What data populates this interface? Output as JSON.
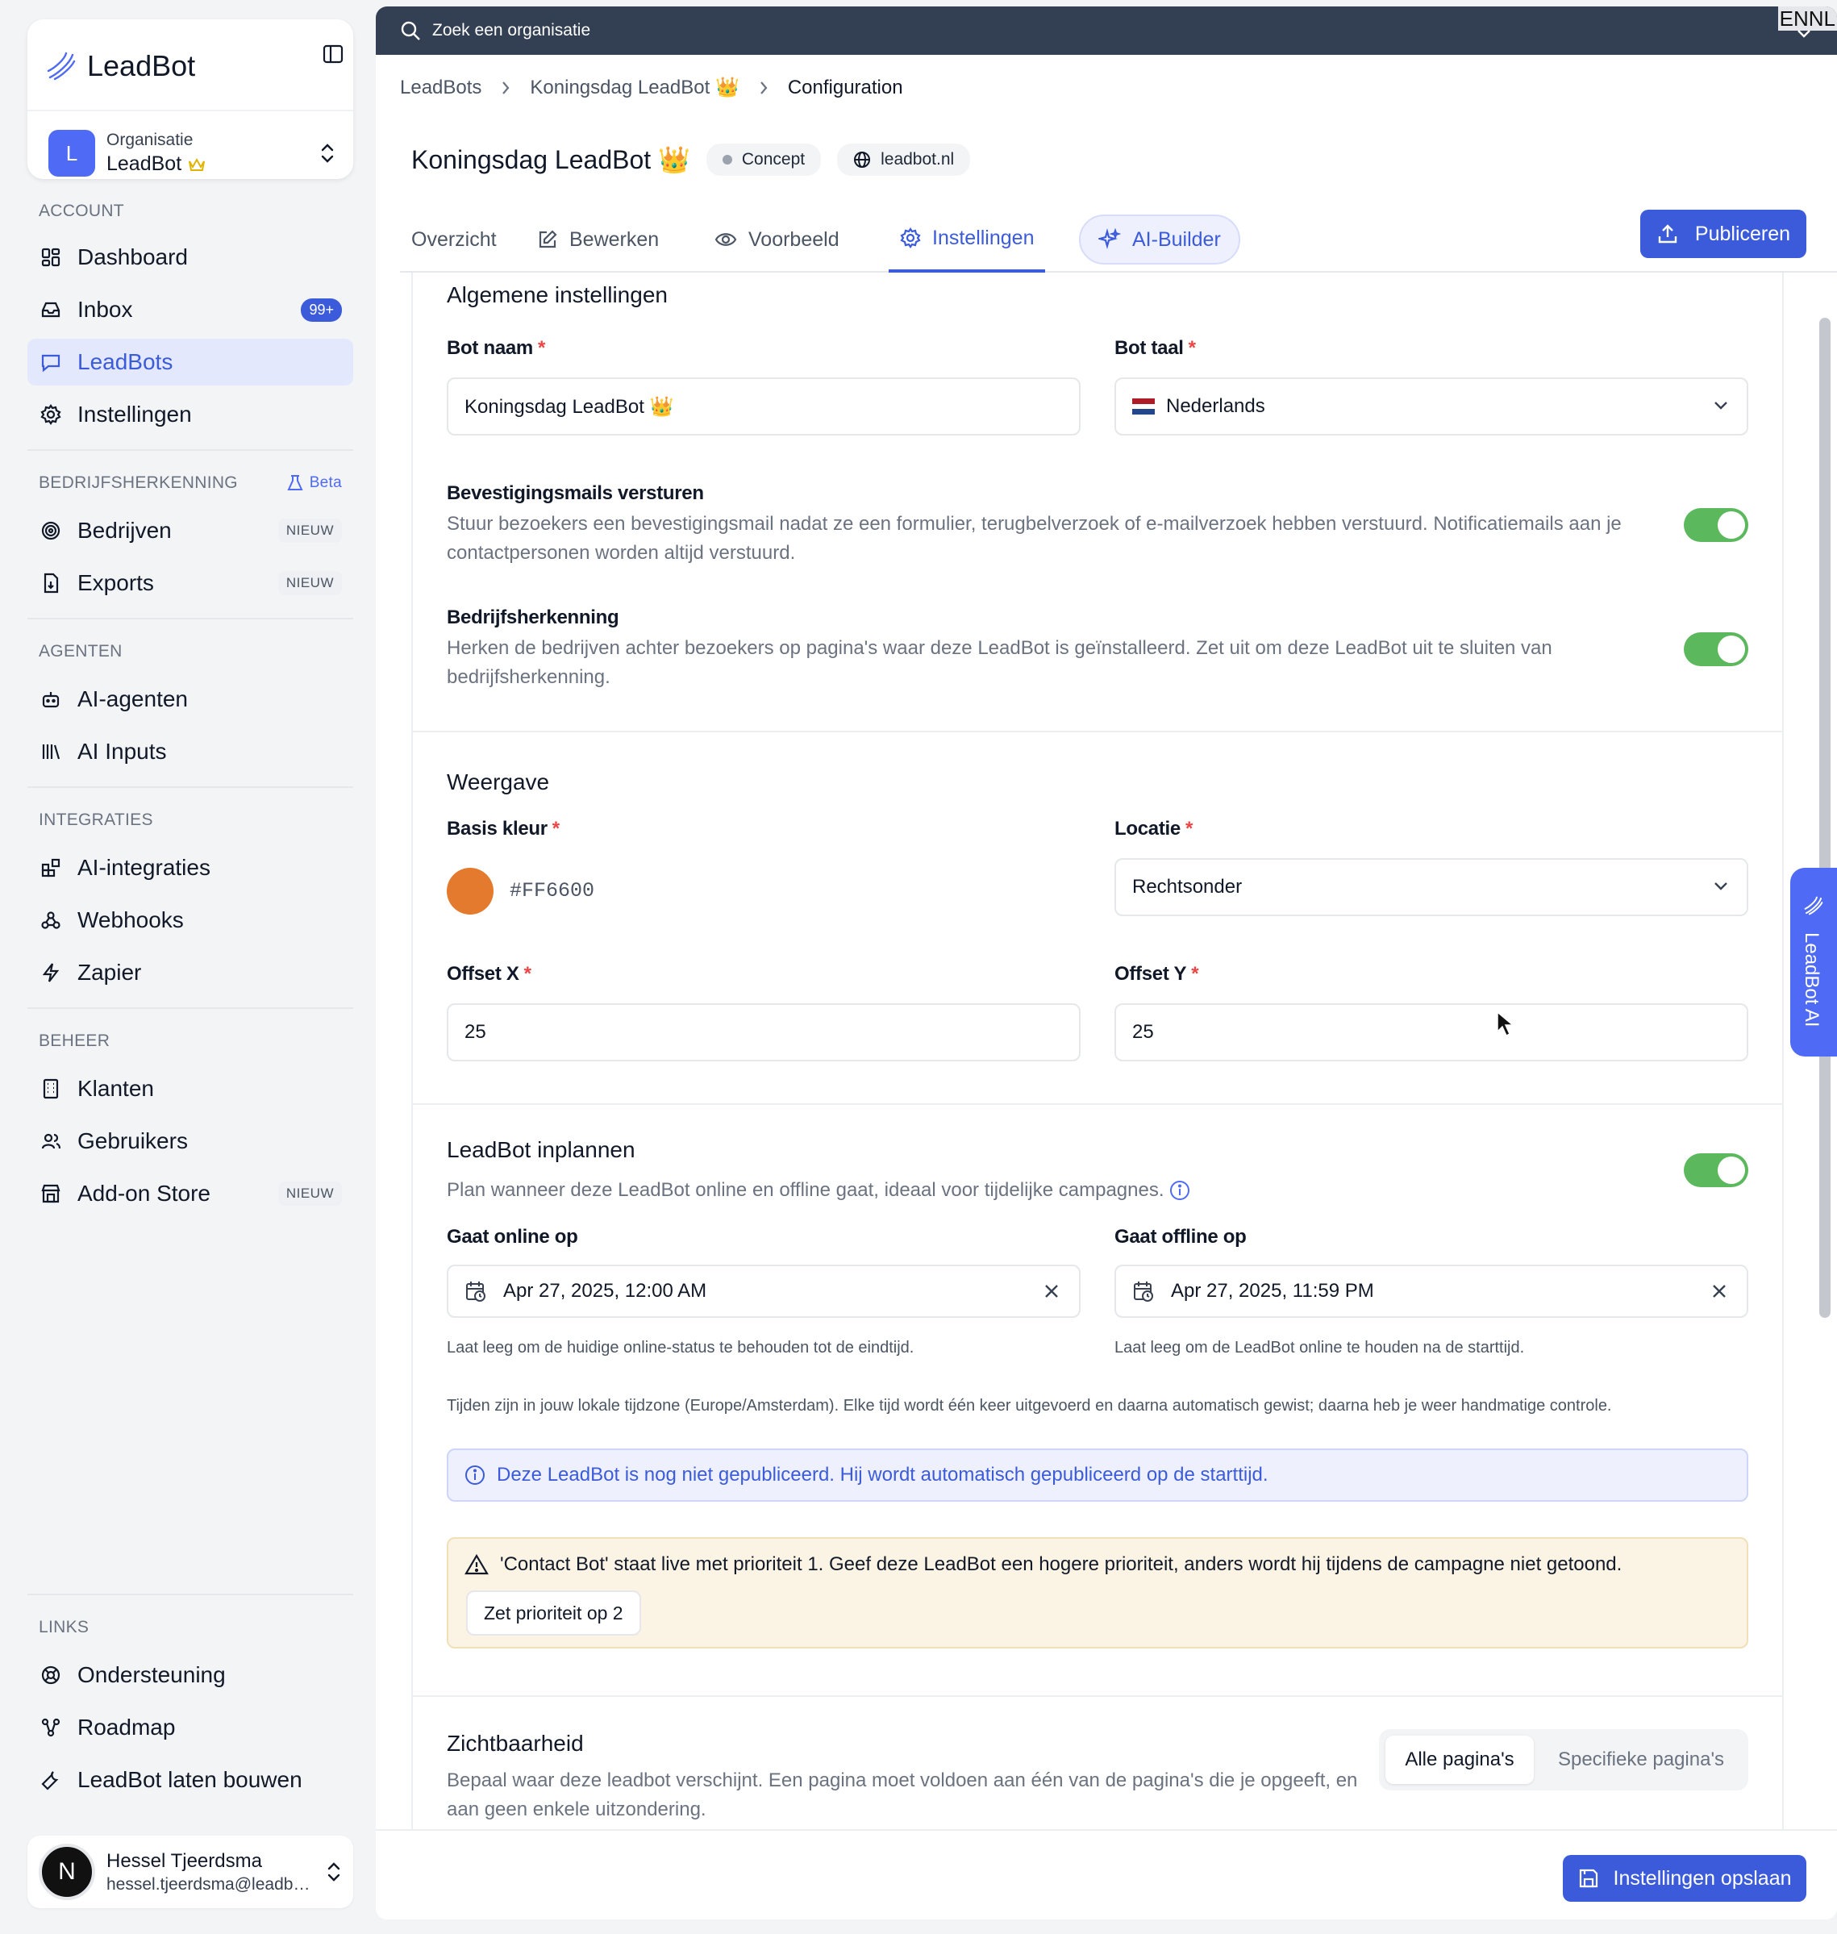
{
  "sidebar": {
    "logo": "LeadBot",
    "org": {
      "label": "Organisatie",
      "name": "LeadBot",
      "avatar": "L"
    },
    "sections": {
      "account": "ACCOUNT",
      "bedrijf": "BEDRIJFSHERKENNING",
      "beta": "Beta",
      "agenten": "AGENTEN",
      "integraties": "INTEGRATIES",
      "beheer": "BEHEER",
      "links": "LINKS"
    },
    "items": {
      "dashboard": "Dashboard",
      "inbox": "Inbox",
      "inbox_count": "99+",
      "leadbots": "LeadBots",
      "instellingen": "Instellingen",
      "bedrijven": "Bedrijven",
      "exports": "Exports",
      "ai_agenten": "AI-agenten",
      "ai_inputs": "AI Inputs",
      "ai_integraties": "AI-integraties",
      "webhooks": "Webhooks",
      "zapier": "Zapier",
      "klanten": "Klanten",
      "gebruikers": "Gebruikers",
      "addon": "Add-on Store",
      "ondersteuning": "Ondersteuning",
      "roadmap": "Roadmap",
      "laten_bouwen": "LeadBot laten bouwen"
    },
    "new_badge": "NIEUW",
    "user": {
      "name": "Hessel Tjeerdsma",
      "email": "hessel.tjeerdsma@leadbot...",
      "avatar": "N"
    }
  },
  "topbar": {
    "search_placeholder": "Zoek een organisatie",
    "lang": "ENNL"
  },
  "breadcrumb": {
    "root": "LeadBots",
    "bot": "Koningsdag LeadBot 👑",
    "current": "Configuration"
  },
  "header": {
    "title": "Koningsdag LeadBot 👑",
    "status": "Concept",
    "domain": "leadbot.nl"
  },
  "tabs": {
    "overzicht": "Overzicht",
    "bewerken": "Bewerken",
    "voorbeeld": "Voorbeeld",
    "instellingen": "Instellingen",
    "ai_builder": "AI-Builder"
  },
  "publish_label": "Publiceren",
  "general": {
    "title": "Algemene instellingen",
    "bot_name_label": "Bot naam",
    "bot_name_value": "Koningsdag LeadBot 👑",
    "bot_lang_label": "Bot taal",
    "bot_lang_value": "Nederlands",
    "confirm_title": "Bevestigingsmails versturen",
    "confirm_desc_1": "Stuur bezoekers een bevestigingsmail nadat ze een formulier, terugbelverzoek of e-mailverzoek hebben verstuurd. Notificatiemails aan je",
    "confirm_desc_2": "contactpersonen worden altijd verstuurd.",
    "recog_title": "Bedrijfsherkenning",
    "recog_desc_1": "Herken de bedrijven achter bezoekers op pagina's waar deze LeadBot is geïnstalleerd. Zet uit om deze LeadBot uit te sluiten van",
    "recog_desc_2": "bedrijfsherkenning.",
    "confirm_on": true,
    "recog_on": true
  },
  "display": {
    "title": "Weergave",
    "color_label": "Basis kleur",
    "color_value": "#FF6600",
    "color_swatch": "#E37A2E",
    "location_label": "Locatie",
    "location_value": "Rechtsonder",
    "offset_x_label": "Offset X",
    "offset_x_value": "25",
    "offset_y_label": "Offset Y",
    "offset_y_value": "25"
  },
  "schedule": {
    "title": "LeadBot inplannen",
    "desc": "Plan wanneer deze LeadBot online en offline gaat, ideaal voor tijdelijke campagnes.",
    "enabled": true,
    "online_label": "Gaat online op",
    "online_value": "Apr 27, 2025, 12:00 AM",
    "online_hint": "Laat leeg om de huidige online-status te behouden tot de eindtijd.",
    "offline_label": "Gaat offline op",
    "offline_value": "Apr 27, 2025, 11:59 PM",
    "offline_hint": "Laat leeg om de LeadBot online te houden na de starttijd.",
    "timezone_note": "Tijden zijn in jouw lokale tijdzone (Europe/Amsterdam). Elke tijd wordt één keer uitgevoerd en daarna automatisch gewist; daarna heb je weer handmatige controle.",
    "info": "Deze LeadBot is nog niet gepubliceerd. Hij wordt automatisch gepubliceerd op de starttijd.",
    "warning": "'Contact Bot' staat live met prioriteit 1. Geef deze LeadBot een hogere prioriteit, anders wordt hij tijdens de campagne niet getoond.",
    "warning_button": "Zet prioriteit op 2"
  },
  "visibility": {
    "title": "Zichtbaarheid",
    "desc_1": "Bepaal waar deze leadbot verschijnt. Een pagina moet voldoen aan één van de pagina's die je opgeeft, en",
    "desc_2": "aan geen enkele uitzondering.",
    "all": "Alle pagina's",
    "specific": "Specifieke pagina's"
  },
  "save_label": "Instellingen opslaan",
  "side_tab": "LeadBot AI",
  "colors": {
    "accent": "#3B5BDB",
    "toggle_on": "#5CB85C",
    "topbar": "#333F52"
  }
}
